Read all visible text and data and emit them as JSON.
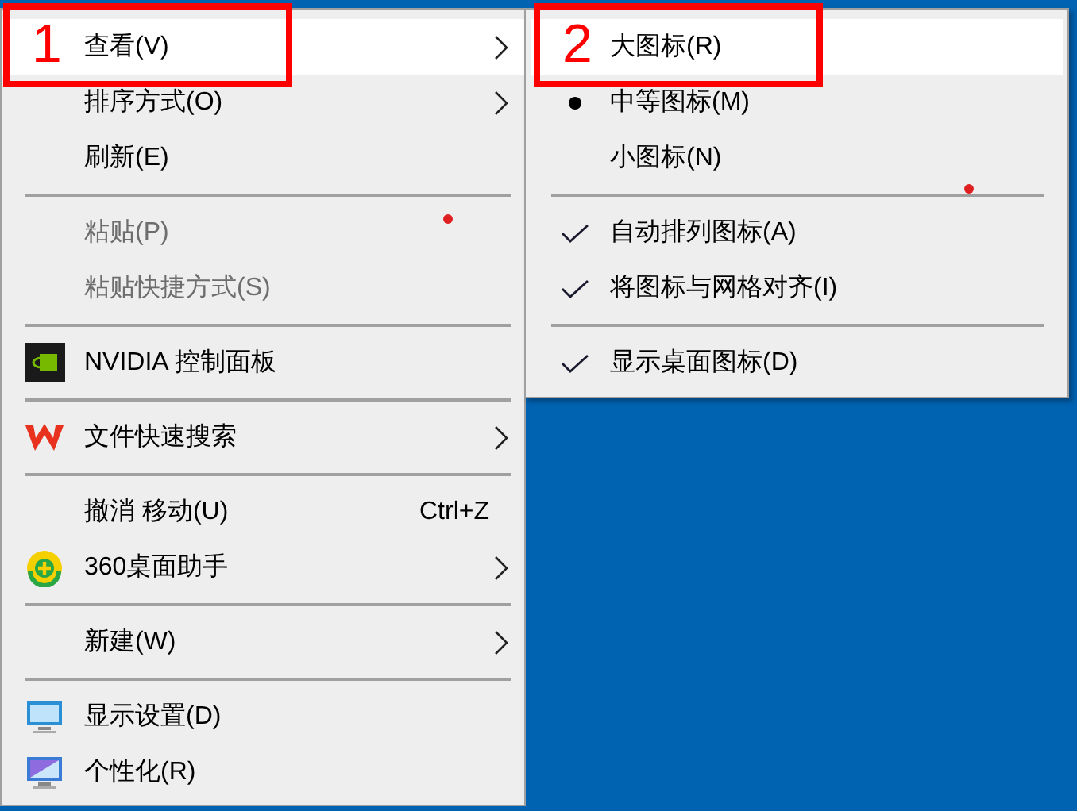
{
  "menu": {
    "items": [
      {
        "kind": "item",
        "label": "查看(V)",
        "highlighted": true,
        "disabled": false,
        "has_submenu": true,
        "callout": "1"
      },
      {
        "kind": "item",
        "label": "排序方式(O)",
        "highlighted": false,
        "disabled": false,
        "has_submenu": true
      },
      {
        "kind": "item",
        "label": "刷新(E)",
        "highlighted": false,
        "disabled": false,
        "has_submenu": false
      },
      {
        "kind": "separator"
      },
      {
        "kind": "item",
        "label": "粘贴(P)",
        "highlighted": false,
        "disabled": true,
        "has_submenu": false
      },
      {
        "kind": "item",
        "label": "粘贴快捷方式(S)",
        "highlighted": false,
        "disabled": true,
        "has_submenu": false
      },
      {
        "kind": "separator"
      },
      {
        "kind": "item",
        "label": "NVIDIA 控制面板",
        "highlighted": false,
        "disabled": false,
        "has_submenu": false
      },
      {
        "kind": "separator"
      },
      {
        "kind": "item",
        "label": "文件快速搜索",
        "highlighted": false,
        "disabled": false,
        "has_submenu": true
      },
      {
        "kind": "separator"
      },
      {
        "kind": "item",
        "label": "撤消 移动(U)",
        "shortcut": "Ctrl+Z",
        "highlighted": false,
        "disabled": false,
        "has_submenu": false
      },
      {
        "kind": "item",
        "label": "360桌面助手",
        "highlighted": false,
        "disabled": false,
        "has_submenu": true
      },
      {
        "kind": "separator"
      },
      {
        "kind": "item",
        "label": "新建(W)",
        "highlighted": false,
        "disabled": false,
        "has_submenu": true
      },
      {
        "kind": "separator"
      },
      {
        "kind": "item",
        "label": "显示设置(D)",
        "highlighted": false,
        "disabled": false,
        "has_submenu": false
      },
      {
        "kind": "item",
        "label": "个性化(R)",
        "highlighted": false,
        "disabled": false,
        "has_submenu": false
      }
    ]
  },
  "submenu": {
    "items": [
      {
        "kind": "radio",
        "label": "大图标(R)",
        "selected": false,
        "highlighted": true,
        "callout": "2"
      },
      {
        "kind": "radio",
        "label": "中等图标(M)",
        "selected": true,
        "highlighted": false
      },
      {
        "kind": "radio",
        "label": "小图标(N)",
        "selected": false,
        "highlighted": false
      },
      {
        "kind": "separator"
      },
      {
        "kind": "check",
        "label": "自动排列图标(A)",
        "checked": true,
        "highlighted": false
      },
      {
        "kind": "check",
        "label": "将图标与网格对齐(I)",
        "checked": true,
        "highlighted": false
      },
      {
        "kind": "separator"
      },
      {
        "kind": "check",
        "label": "显示桌面图标(D)",
        "checked": true,
        "highlighted": false
      }
    ]
  }
}
